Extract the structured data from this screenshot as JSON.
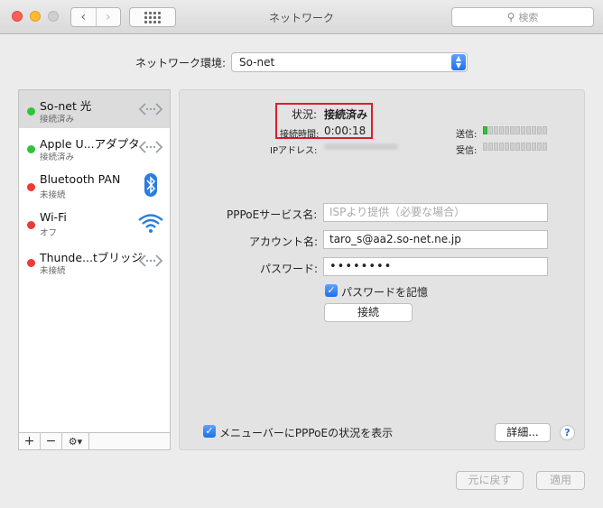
{
  "window": {
    "title": "ネットワーク"
  },
  "search": {
    "placeholder": "検索"
  },
  "location": {
    "label": "ネットワーク環境:",
    "value": "So-net"
  },
  "services": [
    {
      "name": "So-net 光",
      "status": "接続済み",
      "indicator": "#30c33a",
      "icon": "ppp-arrows-icon"
    },
    {
      "name": "Apple U...アダプタ",
      "status": "接続済み",
      "indicator": "#30c33a",
      "icon": "ethernet-arrows-icon"
    },
    {
      "name": "Bluetooth PAN",
      "status": "未接続",
      "indicator": "#eb3b36",
      "icon": "bluetooth-icon"
    },
    {
      "name": "Wi-Fi",
      "status": "オフ",
      "indicator": "#eb3b36",
      "icon": "wifi-icon"
    },
    {
      "name": "Thunde...tブリッジ",
      "status": "未接続",
      "indicator": "#eb3b36",
      "icon": "bridge-arrows-icon"
    }
  ],
  "status": {
    "state_label": "状況:",
    "state_value": "接続済み",
    "time_label": "接続時間:",
    "time_value": "0:00:18",
    "ip_label": "IPアドレス:",
    "sent_label": "送信:",
    "received_label": "受信:"
  },
  "form": {
    "service_name_label": "PPPoEサービス名:",
    "service_name_placeholder": "ISPより提供（必要な場合）",
    "account_label": "アカウント名:",
    "account_value": "taro_s@aa2.so-net.ne.jp",
    "password_label": "パスワード:",
    "password_value": "••••••••",
    "remember_label": "パスワードを記憶",
    "connect_label": "接続"
  },
  "bottom": {
    "menu_checkbox_label": "メニューバーにPPPoEの状況を表示",
    "details_label": "詳細...",
    "help_label": "?",
    "revert_label": "元に戻す",
    "apply_label": "適用"
  },
  "sidebar_controls": {
    "add": "+",
    "remove": "−",
    "gear": "⚙▾"
  }
}
